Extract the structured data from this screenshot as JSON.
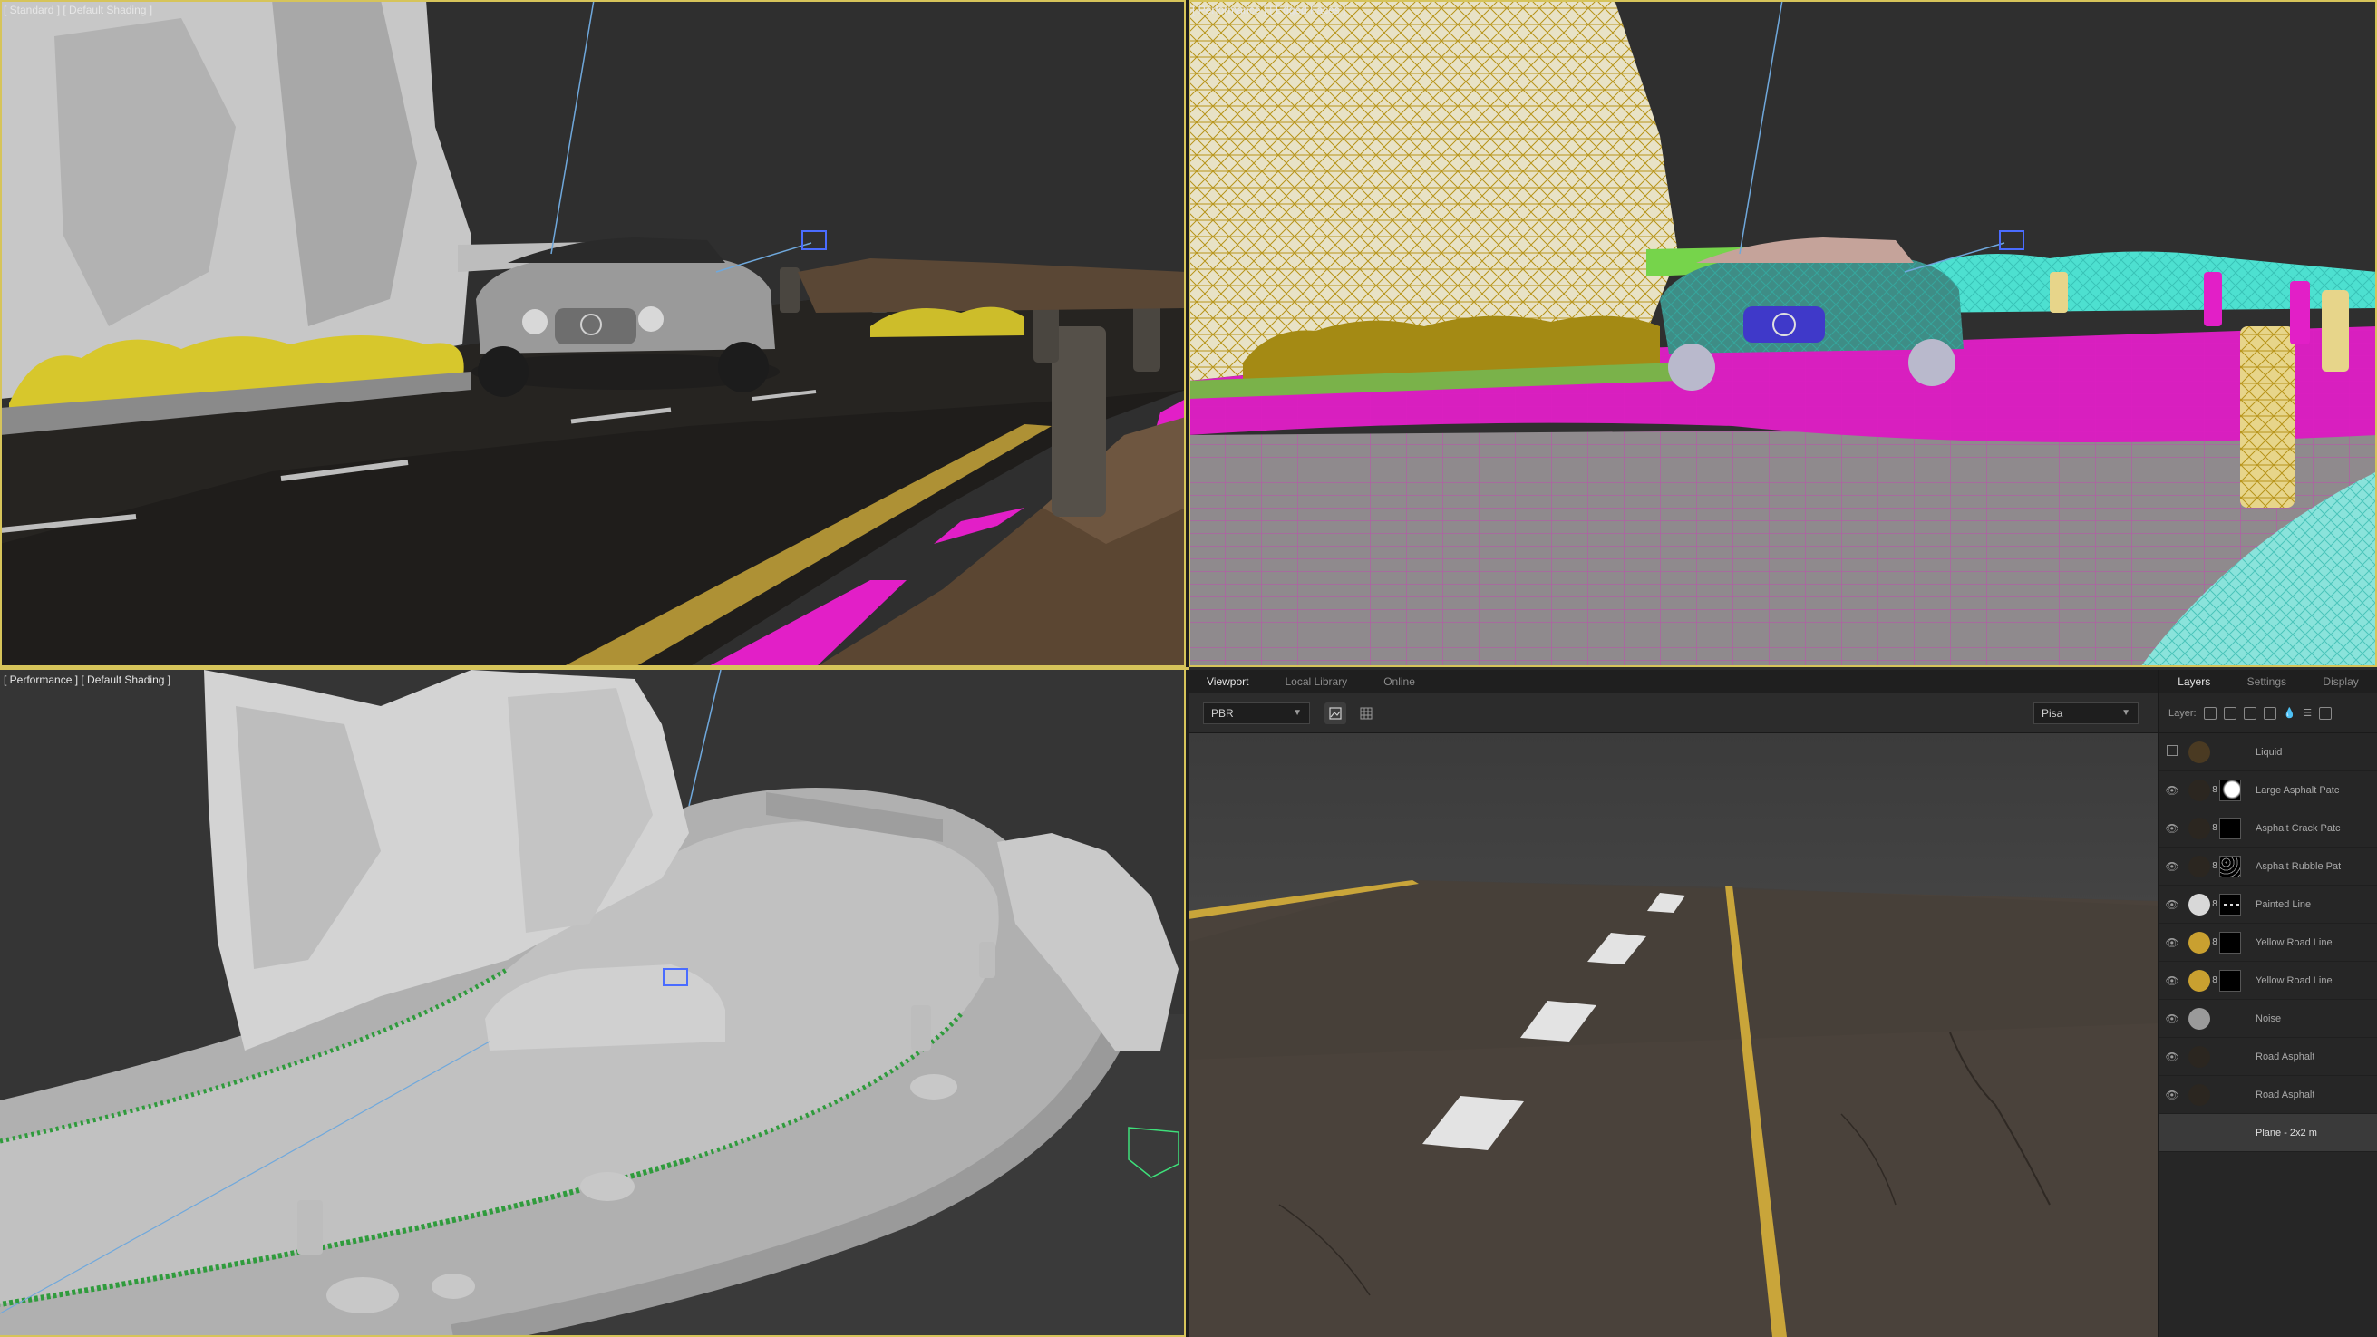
{
  "viewports": {
    "top_left": {
      "label": "[ Standard ] [ Default Shading ]"
    },
    "top_right": {
      "label": "[ Performance ] [ Edged Faces ]"
    },
    "bottom_left": {
      "label": "[ Performance ] [ Default Shading ]"
    }
  },
  "painter": {
    "tabs": [
      "Viewport",
      "Local Library",
      "Online"
    ],
    "active_tab": "Viewport",
    "shader_select": "PBR",
    "environment_select": "Pisa",
    "layers_panel": {
      "tabs": [
        "Layers",
        "Settings",
        "Display"
      ],
      "active_tab": "Layers",
      "toolbar_label": "Layer:",
      "layers": [
        {
          "name": "Liquid",
          "visible": false,
          "thumb_color": "#4a3a22",
          "mask": "none"
        },
        {
          "name": "Large Asphalt Patc",
          "visible": true,
          "thumb_color": "#2b2620",
          "mask": "white-patch"
        },
        {
          "name": "Asphalt Crack Patc",
          "visible": true,
          "thumb_color": "#2b2620",
          "mask": "black"
        },
        {
          "name": "Asphalt Rubble Pat",
          "visible": true,
          "thumb_color": "#2b2620",
          "mask": "speckle"
        },
        {
          "name": "Painted Line",
          "visible": true,
          "thumb_color": "#d8d8d8",
          "mask": "dashed"
        },
        {
          "name": "Yellow Road Line",
          "visible": true,
          "thumb_color": "#c9a030",
          "mask": "black"
        },
        {
          "name": "Yellow Road Line",
          "visible": true,
          "thumb_color": "#c9a030",
          "mask": "black"
        },
        {
          "name": "Noise",
          "visible": true,
          "thumb_color": "#9a9a9a",
          "mask": "none"
        },
        {
          "name": "Road Asphalt",
          "visible": true,
          "thumb_color": "#2b2620",
          "mask": "none"
        },
        {
          "name": "Road Asphalt",
          "visible": true,
          "thumb_color": "#2b2620",
          "mask": "none"
        },
        {
          "name": "Plane - 2x2 m",
          "visible": null,
          "thumb_color": "#3a3a3a",
          "mask": "none",
          "selected": true
        }
      ]
    }
  },
  "colors": {
    "active_viewport_border": "#d6c45a",
    "selection_magenta": "#e21fc7",
    "rock_wire": "#c8a826",
    "foliage_cyan": "#4de0d0"
  }
}
